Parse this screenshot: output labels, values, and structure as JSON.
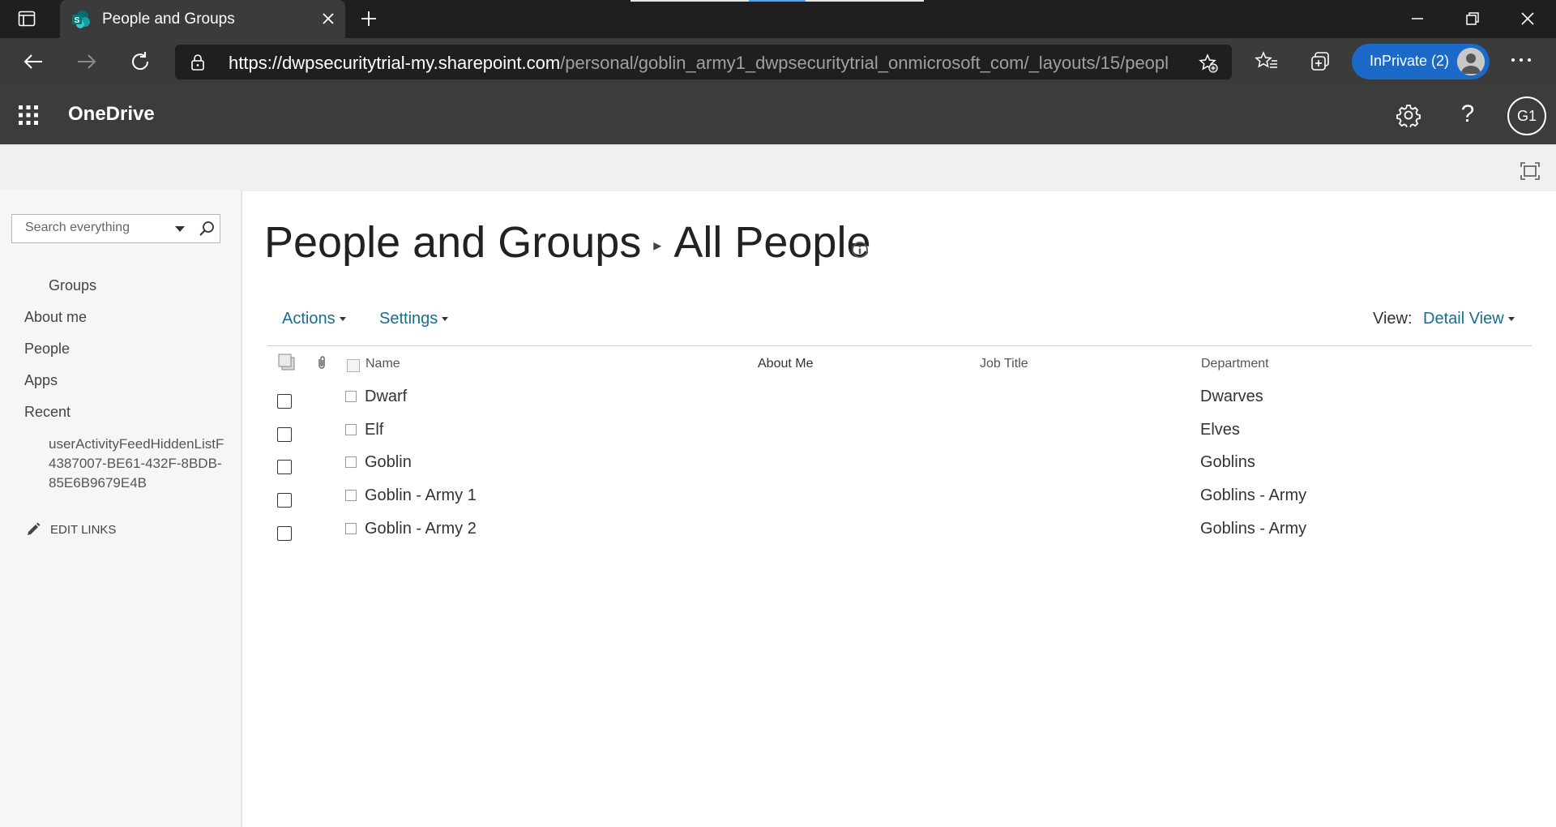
{
  "browser": {
    "tab_title": "People and Groups",
    "url_host": "https://dwpsecuritytrial-my.sharepoint.com",
    "url_path": "/personal/goblin_army1_dwpsecuritytrial_onmicrosoft_com/_layouts/15/people.as...",
    "inprivate_label": "InPrivate (2)"
  },
  "suite": {
    "app_name": "OneDrive",
    "help_label": "?",
    "user_initials": "G1"
  },
  "leftnav": {
    "search_placeholder": "Search everything",
    "items": [
      {
        "label": "Groups"
      },
      {
        "label": "About me"
      },
      {
        "label": "People"
      },
      {
        "label": "Apps"
      },
      {
        "label": "Recent"
      }
    ],
    "recent_item": "userActivityFeedHiddenListF4387007-BE61-432F-8BDB-85E6B9679E4B",
    "edit_links": "EDIT LINKS"
  },
  "page": {
    "title": "People and Groups",
    "separator": "▸",
    "subtitle": "All People"
  },
  "commands": {
    "actions": "Actions",
    "settings": "Settings",
    "view_label": "View:",
    "view_value": "Detail View"
  },
  "table": {
    "columns": [
      "Name",
      "About Me",
      "Job Title",
      "Department"
    ],
    "rows": [
      {
        "name": "Dwarf",
        "about": "",
        "job_title": "",
        "department": "Dwarves"
      },
      {
        "name": "Elf",
        "about": "",
        "job_title": "",
        "department": "Elves"
      },
      {
        "name": "Goblin",
        "about": "",
        "job_title": "",
        "department": "Goblins"
      },
      {
        "name": "Goblin - Army 1",
        "about": "",
        "job_title": "",
        "department": "Goblins - Army"
      },
      {
        "name": "Goblin - Army 2",
        "about": "",
        "job_title": "",
        "department": "Goblins - Army"
      }
    ]
  },
  "colors": {
    "link": "#1b6c8a",
    "suite_bar": "#3c3c3c",
    "inprivate": "#1b6ac9"
  }
}
